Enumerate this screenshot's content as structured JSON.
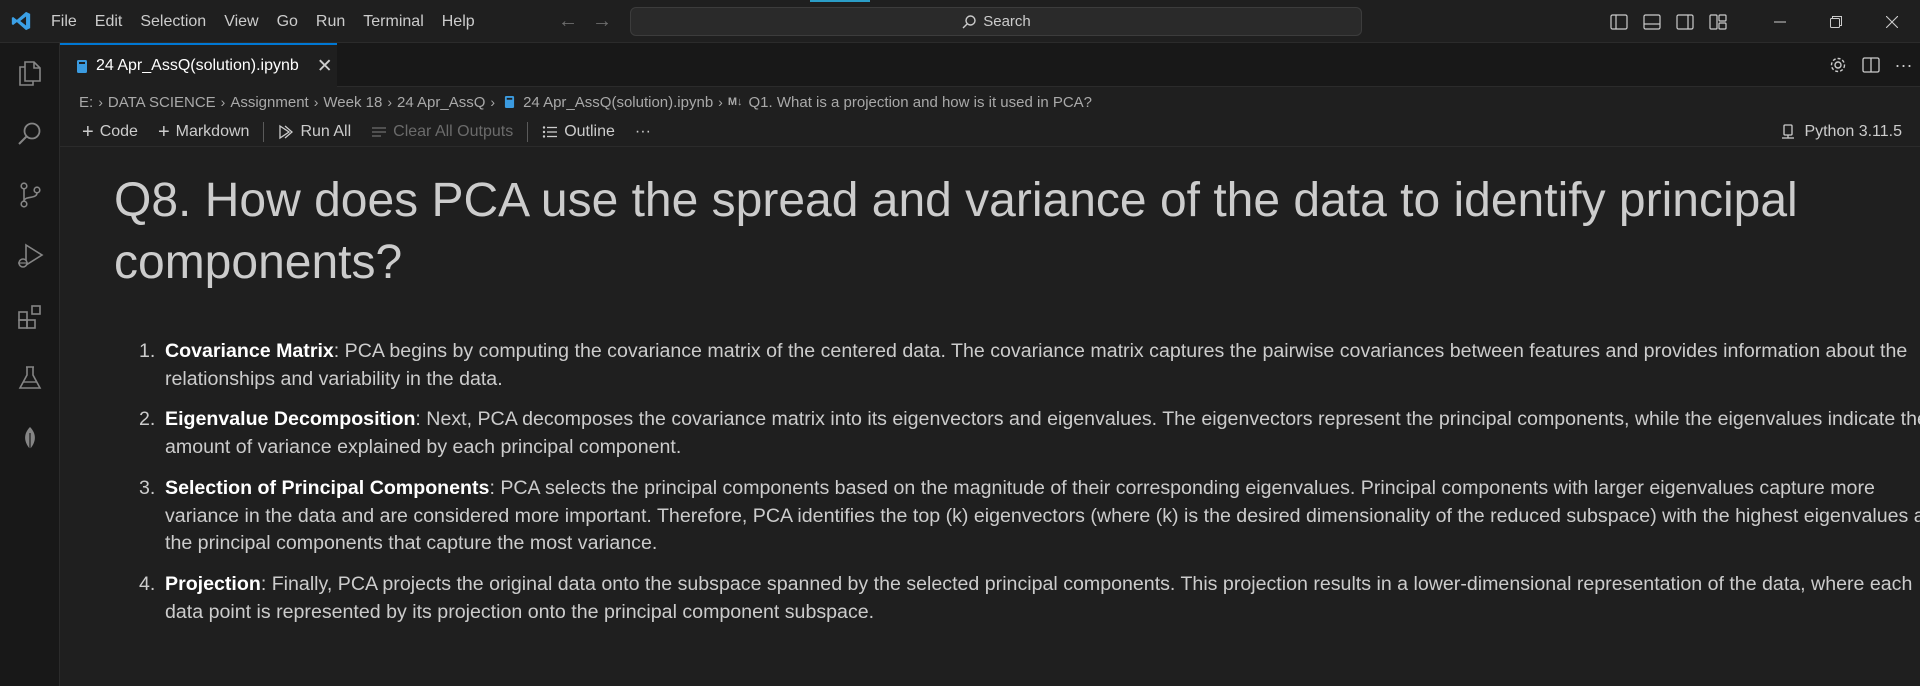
{
  "menu": [
    "File",
    "Edit",
    "Selection",
    "View",
    "Go",
    "Run",
    "Terminal",
    "Help"
  ],
  "search": {
    "label": "Search"
  },
  "tab": {
    "title": "24 Apr_AssQ(solution).ipynb"
  },
  "breadcrumb": {
    "items": [
      "E:",
      "DATA SCIENCE",
      "Assignment",
      "Week 18",
      "24 Apr_AssQ",
      "24 Apr_AssQ(solution).ipynb",
      "Q1. What is a projection and how is it used in PCA?"
    ]
  },
  "toolbar": {
    "code": "Code",
    "markdown": "Markdown",
    "run_all": "Run All",
    "clear_outputs": "Clear All Outputs",
    "outline": "Outline",
    "more": "···",
    "kernel": "Python 3.11.5"
  },
  "cell": {
    "heading": "Q8. How does PCA use the spread and variance of the data to identify principal components?",
    "points": [
      {
        "num": "1.",
        "title": "Covariance Matrix",
        "text": ": PCA begins by computing the covariance matrix of the centered data. The covariance matrix captures the pairwise covariances between features and provides information about the relationships and variability in the data."
      },
      {
        "num": "2.",
        "title": "Eigenvalue Decomposition",
        "text": ": Next, PCA decomposes the covariance matrix into its eigenvectors and eigenvalues. The eigenvectors represent the principal components, while the eigenvalues indicate the amount of variance explained by each principal component."
      },
      {
        "num": "3.",
        "title": "Selection of Principal Components",
        "text": ": PCA selects the principal components based on the magnitude of their corresponding eigenvalues. Principal components with larger eigenvalues capture more variance in the data and are considered more important. Therefore, PCA identifies the top (k) eigenvectors (where (k) is the desired dimensionality of the reduced subspace) with the highest eigenvalues as the principal components that capture the most variance."
      },
      {
        "num": "4.",
        "title": "Projection",
        "text": ": Finally, PCA projects the original data onto the subspace spanned by the selected principal components. This projection results in a lower-dimensional representation of the data, where each data point is represented by its projection onto the principal component subspace."
      }
    ]
  },
  "colors": {
    "accent": "#0078d4",
    "logo": "#3ba0e6"
  },
  "icons": [
    "vscode-logo-icon",
    "explorer-icon",
    "search-icon",
    "source-control-icon",
    "run-debug-icon",
    "extensions-icon",
    "testing-icon",
    "leaf-icon",
    "gear-icon",
    "split-editor-icon",
    "notebook-file-icon",
    "markdown-icon",
    "kernel-icon"
  ]
}
